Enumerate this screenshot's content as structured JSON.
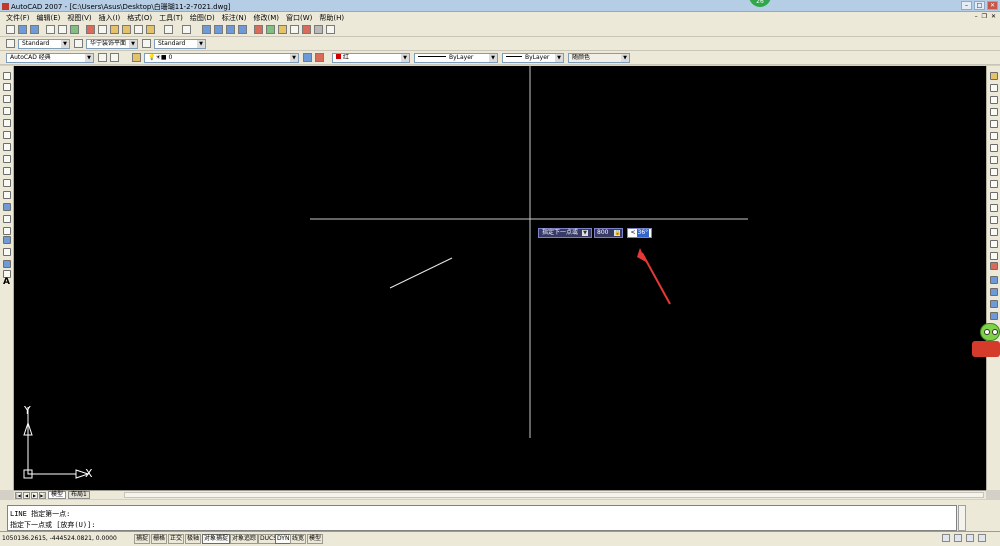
{
  "window": {
    "title": "AutoCAD 2007 - [C:\\Users\\Asus\\Desktop\\白珊瑚11-2-7021.dwg]",
    "notification_badge": "26"
  },
  "menu": [
    "文件(F)",
    "编辑(E)",
    "视图(V)",
    "插入(I)",
    "格式(O)",
    "工具(T)",
    "绘图(D)",
    "标注(N)",
    "修改(M)",
    "窗口(W)",
    "帮助(H)"
  ],
  "styles_toolbar": {
    "text_style": "Standard",
    "dim_style": "华宁装饰平面",
    "table_style": "Standard"
  },
  "workspace": "AutoCAD 经典",
  "layer": "0",
  "properties": {
    "color": "红",
    "linetype": "ByLayer",
    "lineweight": "ByLayer",
    "plot_style": "随颜色"
  },
  "dynamic_input": {
    "prompt": "指定下一点或",
    "length": "800",
    "angle": "36°"
  },
  "ucs": {
    "x_label": "X",
    "y_label": "Y"
  },
  "layout_tabs": [
    "模型",
    "布局1"
  ],
  "command_history": [
    "LINE 指定第一点:",
    "指定下一点或 [放弃(U)]:"
  ],
  "status": {
    "coordinates": "1050136.2615, -444524.0821, 0.0000",
    "toggles": [
      "捕捉",
      "栅格",
      "正交",
      "极轴",
      "对象捕捉",
      "对象追踪",
      "DUCS",
      "DYN",
      "线宽",
      "模型"
    ]
  },
  "colors": {
    "canvas": "#000000",
    "crosshair": "#c8c8c8",
    "annotation_arrow": "#e53935"
  }
}
